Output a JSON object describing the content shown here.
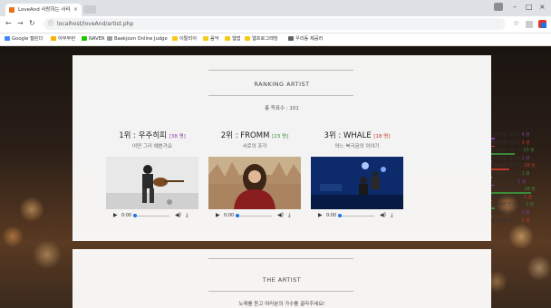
{
  "browser": {
    "tab_title": "LoveAnd 사랑하는 사라",
    "tab_close": "×",
    "url": "localhost/loveAnd/artist.php",
    "bookmarks": [
      "Google 캘린더",
      "아무무런",
      "NAVER",
      "Baekjoon Online Judge",
      "이탈리아",
      "음악",
      "웹앱",
      "웹프로그래밍",
      "우리동 제공러"
    ]
  },
  "ranking": {
    "title": "RANKING ARTIST",
    "total": "총 득표수 : 101",
    "cards": [
      {
        "rank": "1위 : 우주히피",
        "votes": "[38 명]",
        "song": "어떤 그리 예쁜가요",
        "time": "0:00",
        "votes_color": "#7a3fa0"
      },
      {
        "rank": "2위 : FROMM",
        "votes": "[23 명]",
        "song": "서로의 조각",
        "time": "0:00",
        "votes_color": "#3a8a3a"
      },
      {
        "rank": "3위 : WHALE",
        "votes": "[18 명]",
        "song": "어느 북극곰의 이야기",
        "time": "0:00",
        "votes_color": "#c0392b"
      }
    ],
    "list": [
      {
        "name": "신나는밤 (3 %)",
        "n": "4 명",
        "color": "#7a3fa0",
        "pct": 3
      },
      {
        "name": "제이구청 (3 %)",
        "n": "3 명",
        "color": "#c0392b",
        "pct": 3
      },
      {
        "name": "Fromm (22 %)",
        "n": "23 명",
        "color": "#3a8a3a",
        "pct": 22
      },
      {
        "name": "치즈달빛 (1 %)",
        "n": "1 명",
        "color": "#7a3fa0",
        "pct": 1
      },
      {
        "name": "WHALE (17 %)",
        "n": "18 명",
        "color": "#c0392b",
        "pct": 17
      },
      {
        "name": "바닐라앤 (1 %)",
        "n": "1 명",
        "color": "#3a8a3a",
        "pct": 1
      },
      {
        "name": "윤지영 (3 %)",
        "n": "1 명",
        "color": "#7a3fa0",
        "pct": 3
      },
      {
        "name": "우주히피 (37 %)",
        "n": "38 명",
        "color": "#3a8a3a",
        "pct": 37
      },
      {
        "name": "April2nd (0 %)",
        "n": "1 명",
        "color": "#c0392b",
        "pct": 0
      },
      {
        "name": "브로커리안 (3 %)",
        "n": "3 명",
        "color": "#3a8a3a",
        "pct": 3
      },
      {
        "name": "검정치마 (0 %)",
        "n": "1 명",
        "color": "#7a3fa0",
        "pct": 0
      },
      {
        "name": "옥상달빛 (1 %)",
        "n": "2 명",
        "color": "#c0392b",
        "pct": 1
      }
    ]
  },
  "artist_section": {
    "title": "THE ARTIST",
    "subtitle": "노래를 듣고 여러분의 가수를 골라주세요!"
  }
}
